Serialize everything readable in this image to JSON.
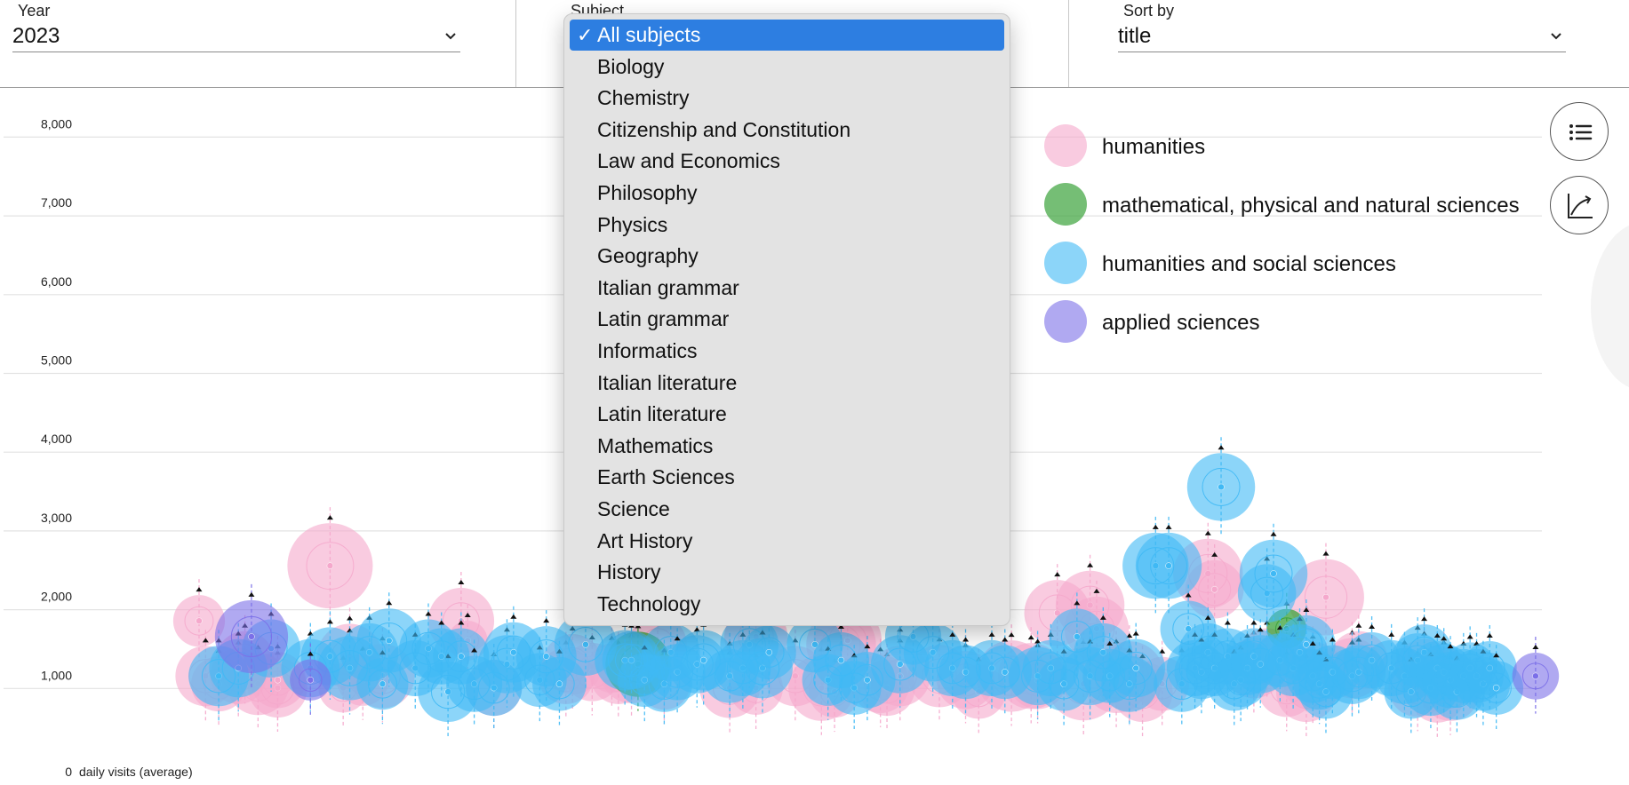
{
  "filters": {
    "year": {
      "label": "Year",
      "value": "2023"
    },
    "subject": {
      "label": "Subject"
    },
    "sort": {
      "label": "Sort by",
      "value": "title"
    }
  },
  "dropdown": {
    "options": [
      "All subjects",
      "Biology",
      "Chemistry",
      "Citizenship and Constitution",
      "Law and Economics",
      "Philosophy",
      "Physics",
      "Geography",
      "Italian grammar",
      "Latin grammar",
      "Informatics",
      "Italian literature",
      "Latin literature",
      "Mathematics",
      "Earth Sciences",
      "Science",
      "Art History",
      "History",
      "Technology"
    ],
    "selected_index": 0,
    "check_glyph": "✓"
  },
  "buttons": {
    "list_icon": "list-icon",
    "chart_icon": "trend-chart-icon"
  },
  "colors": {
    "humanities": "#f5a8cc",
    "mathematical, physical and natural sciences": "#3aa23a",
    "humanities and social sciences": "#3fb9f5",
    "applied sciences": "#7b6fe8"
  },
  "chart_data": {
    "type": "scatter",
    "xlabel": "",
    "ylabel": "daily visits (average)",
    "ylim": [
      0,
      8000
    ],
    "yticks": [
      0,
      1000,
      2000,
      3000,
      4000,
      5000,
      6000,
      7000,
      8000
    ],
    "ytick_labels": [
      "0",
      "1,000",
      "2,000",
      "3,000",
      "4,000",
      "5,000",
      "6,000",
      "7,000",
      "8,000"
    ],
    "grid": true,
    "legend": "top-right",
    "series": [
      {
        "name": "humanities",
        "color": "#f5a8cc",
        "x": [
          8,
          9,
          11,
          14,
          15,
          17,
          20,
          20,
          28,
          30,
          31,
          33,
          36,
          48,
          49,
          53,
          64,
          65,
          68,
          71,
          72,
          74,
          78,
          79,
          89,
          93,
          93,
          99,
          103,
          105,
          106,
          107,
          112,
          113,
          115,
          121,
          125,
          127,
          132,
          135,
          136,
          139,
          143,
          144,
          145,
          148,
          150,
          152,
          155,
          162,
          163,
          169,
          171,
          174,
          177,
          178,
          180,
          184,
          185,
          194,
          195,
          197,
          198,
          199
        ],
        "y": [
          1700,
          1000,
          900,
          1000,
          1200,
          900,
          850,
          950,
          2400,
          850,
          1250,
          950,
          1000,
          1700,
          1450,
          850,
          1000,
          1150,
          1050,
          1100,
          1000,
          1050,
          1400,
          900,
          850,
          850,
          1500,
          1000,
          850,
          800,
          1400,
          1450,
          900,
          850,
          1000,
          1000,
          950,
          800,
          1000,
          1000,
          950,
          1800,
          900,
          1900,
          1600,
          950,
          1000,
          800,
          900,
          2300,
          2100,
          1100,
          1250,
          850,
          800,
          1000,
          2000,
          1100,
          1200,
          850,
          1100,
          750,
          1000,
          800
        ],
        "size": [
          2200,
          3000,
          2500,
          2600,
          2800,
          3200,
          2900,
          2600,
          6000,
          2000,
          3500,
          2200,
          3400,
          3600,
          1300,
          2600,
          2600,
          3000,
          2800,
          2000,
          2600,
          3200,
          2800,
          2200,
          3000,
          2400,
          3300,
          3000,
          3600,
          2200,
          4000,
          3800,
          2800,
          2600,
          3000,
          3200,
          2800,
          2400,
          4200,
          3600,
          2800,
          3600,
          4400,
          3900,
          3400,
          3600,
          4000,
          3000,
          2400,
          4000,
          2800,
          3000,
          2600,
          2800,
          3000,
          3800,
          4800,
          3000,
          2800,
          2800,
          2800,
          2400,
          2600,
          2800
        ]
      },
      {
        "name": "mathematical, physical and natural sciences",
        "color": "#3aa23a",
        "x": [
          75,
          174
        ],
        "y": [
          1150,
          1600
        ],
        "size": [
          3500,
          1300
        ]
      },
      {
        "name": "humanities and social sciences",
        "color": "#3fb9f5",
        "x": [
          11,
          14,
          19,
          25,
          28,
          31,
          34,
          36,
          37,
          41,
          43,
          45,
          46,
          48,
          50,
          53,
          55,
          56,
          60,
          61,
          63,
          67,
          73,
          74,
          76,
          79,
          80,
          81,
          84,
          85,
          89,
          91,
          92,
          94,
          95,
          102,
          104,
          106,
          108,
          110,
          115,
          117,
          120,
          123,
          125,
          129,
          131,
          136,
          138,
          140,
          142,
          144,
          146,
          147,
          150,
          151,
          154,
          156,
          158,
          159,
          160,
          161,
          162,
          163,
          164,
          165,
          166,
          167,
          168,
          169,
          170,
          171,
          172,
          173,
          175,
          176,
          177,
          178,
          179,
          180,
          181,
          184,
          185,
          187,
          190,
          192,
          193,
          194,
          195,
          196,
          197,
          198,
          199,
          200,
          201,
          202,
          203,
          204,
          205,
          206
        ],
        "y": [
          1000,
          1100,
          1350,
          1100,
          1250,
          1100,
          1300,
          900,
          1450,
          1100,
          1350,
          1250,
          800,
          1250,
          900,
          850,
          1150,
          1300,
          950,
          1250,
          900,
          1400,
          1200,
          1200,
          950,
          900,
          1300,
          1050,
          1150,
          1200,
          1000,
          1100,
          1400,
          1100,
          1300,
          1400,
          950,
          1200,
          850,
          950,
          1150,
          1500,
          1300,
          1100,
          1050,
          1100,
          1050,
          1000,
          1100,
          900,
          1500,
          1000,
          1300,
          1000,
          900,
          1100,
          2400,
          2400,
          900,
          1600,
          1100,
          1050,
          1300,
          1100,
          3400,
          1250,
          900,
          950,
          1100,
          1250,
          1150,
          2050,
          2300,
          1200,
          1100,
          1300,
          1400,
          1000,
          900,
          800,
          1050,
          1000,
          1050,
          1200,
          1100,
          1000,
          800,
          1200,
          1300,
          850,
          1100,
          1050,
          950,
          800,
          1000,
          1100,
          1000,
          900,
          1100,
          850
        ],
        "size": [
          3000,
          2800,
          2800,
          2800,
          2800,
          3400,
          2800,
          2200,
          3400,
          2600,
          2800,
          2600,
          3000,
          2600,
          2600,
          2600,
          2800,
          3000,
          2400,
          3000,
          2400,
          3200,
          3000,
          2800,
          2400,
          2600,
          2800,
          2600,
          2800,
          3000,
          2400,
          2600,
          2800,
          3000,
          2400,
          2600,
          2200,
          2600,
          2400,
          2600,
          2800,
          2600,
          2800,
          2600,
          2400,
          2600,
          2400,
          2800,
          2600,
          2400,
          2600,
          2800,
          2800,
          2400,
          2600,
          2800,
          3600,
          3600,
          2600,
          2600,
          2600,
          2400,
          2800,
          2600,
          3800,
          2600,
          2400,
          2400,
          2400,
          2600,
          2800,
          2800,
          3800,
          2400,
          2600,
          2600,
          2800,
          2400,
          2200,
          2400,
          2400,
          2600,
          2400,
          2600,
          2600,
          2600,
          2400,
          2400,
          2600,
          2600,
          2400,
          2600,
          2600,
          2600,
          2400,
          2200,
          2400,
          2400,
          2400,
          2400
        ]
      },
      {
        "name": "applied sciences",
        "color": "#7b6fe8",
        "x": [
          16,
          25,
          212
        ],
        "y": [
          1500,
          950,
          1000
        ],
        "size": [
          4400,
          1400,
          1800
        ]
      }
    ]
  }
}
